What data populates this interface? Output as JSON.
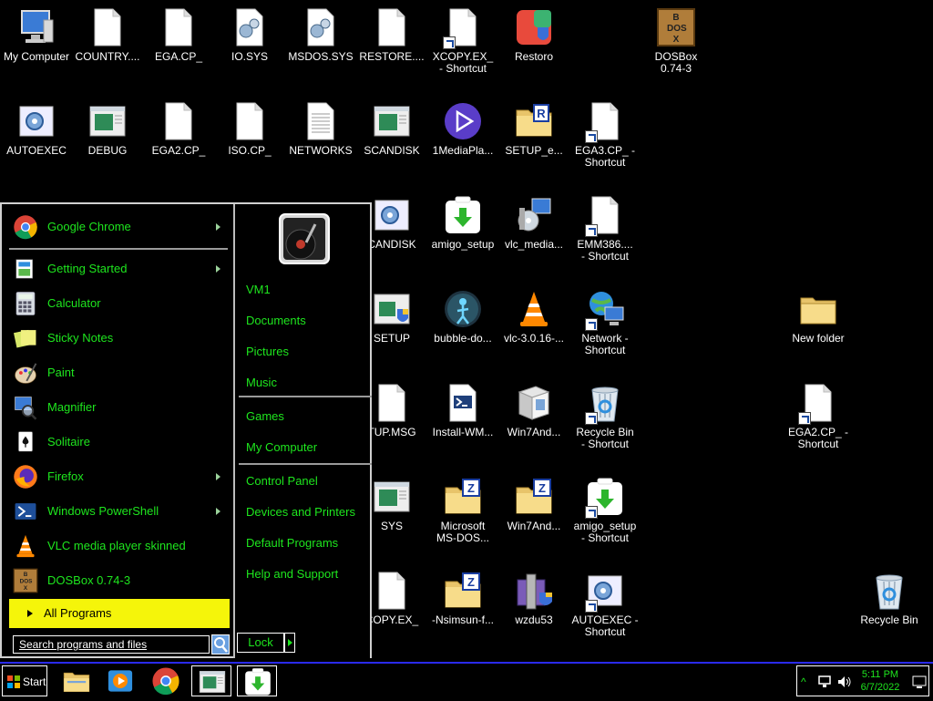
{
  "desktop_icons": [
    {
      "label": "My Computer",
      "icon": "computer-icon",
      "shortcut": false
    },
    {
      "label": "COUNTRY....",
      "icon": "file-icon",
      "shortcut": false
    },
    {
      "label": "EGA.CP_",
      "icon": "file-icon",
      "shortcut": false
    },
    {
      "label": "IO.SYS",
      "icon": "system-file-icon",
      "shortcut": false
    },
    {
      "label": "MSDOS.SYS",
      "icon": "system-file-icon",
      "shortcut": false
    },
    {
      "label": "RESTORE....",
      "icon": "file-icon",
      "shortcut": false
    },
    {
      "label": "XCOPY.EX_\n- Shortcut",
      "icon": "file-icon",
      "shortcut": true
    },
    {
      "label": "Restoro",
      "icon": "restoro-icon",
      "shortcut": false
    },
    {
      "label": "DOSBox\n0.74-3",
      "icon": "dosbox-icon",
      "shortcut": false
    },
    {
      "label": "AUTOEXEC",
      "icon": "gear-file-icon",
      "shortcut": false
    },
    {
      "label": "DEBUG",
      "icon": "window-icon",
      "shortcut": false
    },
    {
      "label": "EGA2.CP_",
      "icon": "file-icon",
      "shortcut": false
    },
    {
      "label": "ISO.CP_",
      "icon": "file-icon",
      "shortcut": false
    },
    {
      "label": "NETWORKS",
      "icon": "text-file-icon",
      "shortcut": false
    },
    {
      "label": "SCANDISK",
      "icon": "window-icon",
      "shortcut": false
    },
    {
      "label": "1MediaPla...",
      "icon": "media-player-icon",
      "shortcut": false
    },
    {
      "label": "SETUP_e...",
      "icon": "folder-r-icon",
      "shortcut": false
    },
    {
      "label": "EGA3.CP_ -\nShortcut",
      "icon": "file-icon",
      "shortcut": true
    },
    {
      "label": "CANDISK",
      "icon": "gear-file-icon",
      "shortcut": false
    },
    {
      "label": "amigo_setup",
      "icon": "download-icon",
      "shortcut": false
    },
    {
      "label": "vlc_media...",
      "icon": "installer-icon",
      "shortcut": false
    },
    {
      "label": "EMM386....\n- Shortcut",
      "icon": "file-icon",
      "shortcut": true
    },
    {
      "label": "SETUP",
      "icon": "window-shield-icon",
      "shortcut": false
    },
    {
      "label": "bubble-do...",
      "icon": "bubble-icon",
      "shortcut": false
    },
    {
      "label": "vlc-3.0.16-...",
      "icon": "vlc-icon",
      "shortcut": false
    },
    {
      "label": "Network -\nShortcut",
      "icon": "network-icon",
      "shortcut": true
    },
    {
      "label": "New folder",
      "icon": "folder-icon",
      "shortcut": false
    },
    {
      "label": "TUP.MSG",
      "icon": "file-icon",
      "shortcut": false
    },
    {
      "label": "Install-WM...",
      "icon": "powershell-file-icon",
      "shortcut": false
    },
    {
      "label": "Win7And...",
      "icon": "box-icon",
      "shortcut": false
    },
    {
      "label": "Recycle Bin\n- Shortcut",
      "icon": "recycle-bin-icon",
      "shortcut": true
    },
    {
      "label": "EGA2.CP_ -\nShortcut",
      "icon": "file-icon",
      "shortcut": true
    },
    {
      "label": "SYS",
      "icon": "window-icon",
      "shortcut": false
    },
    {
      "label": "Microsoft\nMS-DOS...",
      "icon": "zip-folder-icon",
      "shortcut": false
    },
    {
      "label": "Win7And...",
      "icon": "zip-folder-icon",
      "shortcut": false
    },
    {
      "label": "amigo_setup\n- Shortcut",
      "icon": "download-icon",
      "shortcut": true
    },
    {
      "label": "COPY.EX_",
      "icon": "file-icon",
      "shortcut": false
    },
    {
      "label": "-Nsimsun-f...",
      "icon": "zip-folder-icon",
      "shortcut": false
    },
    {
      "label": "wzdu53",
      "icon": "winzip-icon",
      "shortcut": false
    },
    {
      "label": "AUTOEXEC -\nShortcut",
      "icon": "gear-file-icon",
      "shortcut": true
    },
    {
      "label": "Recycle Bin",
      "icon": "recycle-bin-icon",
      "shortcut": false
    }
  ],
  "start_menu": {
    "pinned": [
      {
        "label": "Google Chrome",
        "icon": "chrome-icon",
        "arrow": true
      }
    ],
    "programs": [
      {
        "label": "Getting Started",
        "icon": "getting-started-icon",
        "arrow": true
      },
      {
        "label": "Calculator",
        "icon": "calculator-icon",
        "arrow": false
      },
      {
        "label": "Sticky Notes",
        "icon": "sticky-notes-icon",
        "arrow": false
      },
      {
        "label": "Paint",
        "icon": "paint-icon",
        "arrow": false
      },
      {
        "label": "Magnifier",
        "icon": "magnifier-icon",
        "arrow": false
      },
      {
        "label": "Solitaire",
        "icon": "solitaire-icon",
        "arrow": false
      },
      {
        "label": "Firefox",
        "icon": "firefox-icon",
        "arrow": true
      },
      {
        "label": "Windows PowerShell",
        "icon": "powershell-icon",
        "arrow": true
      },
      {
        "label": "VLC media player skinned",
        "icon": "vlc-icon",
        "arrow": false
      },
      {
        "label": "DOSBox 0.74-3",
        "icon": "dosbox-icon",
        "arrow": false
      }
    ],
    "all_programs": "All Programs",
    "search_placeholder": "Search programs and files",
    "right_links": [
      {
        "label": "VM1"
      },
      {
        "label": "Documents"
      },
      {
        "label": "Pictures"
      },
      {
        "label": "Music"
      },
      {
        "label": "Games"
      },
      {
        "label": "My Computer"
      },
      {
        "label": "Control Panel"
      },
      {
        "label": "Devices and Printers"
      },
      {
        "label": "Default Programs"
      },
      {
        "label": "Help and Support"
      }
    ],
    "lock_label": "Lock"
  },
  "taskbar": {
    "start_label": "Start",
    "apps": [
      {
        "icon": "file-explorer-icon"
      },
      {
        "icon": "media-center-icon"
      },
      {
        "icon": "chrome-icon"
      },
      {
        "icon": "window-icon",
        "active": true
      },
      {
        "icon": "download-icon",
        "active": true
      }
    ],
    "clock_time": "5:11 PM",
    "clock_date": "6/7/2022"
  },
  "colors": {
    "menu_text": "#1ee61e",
    "all_programs_bg": "#f5f50a",
    "taskbar_border": "#2a2af0"
  }
}
